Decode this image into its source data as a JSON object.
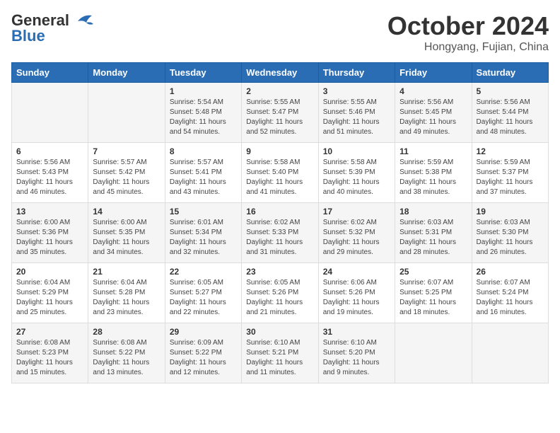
{
  "logo": {
    "text_general": "General",
    "text_blue": "Blue"
  },
  "header": {
    "month": "October 2024",
    "location": "Hongyang, Fujian, China"
  },
  "weekdays": [
    "Sunday",
    "Monday",
    "Tuesday",
    "Wednesday",
    "Thursday",
    "Friday",
    "Saturday"
  ],
  "weeks": [
    [
      {
        "day": "",
        "info": ""
      },
      {
        "day": "",
        "info": ""
      },
      {
        "day": "1",
        "info": "Sunrise: 5:54 AM\nSunset: 5:48 PM\nDaylight: 11 hours and 54 minutes."
      },
      {
        "day": "2",
        "info": "Sunrise: 5:55 AM\nSunset: 5:47 PM\nDaylight: 11 hours and 52 minutes."
      },
      {
        "day": "3",
        "info": "Sunrise: 5:55 AM\nSunset: 5:46 PM\nDaylight: 11 hours and 51 minutes."
      },
      {
        "day": "4",
        "info": "Sunrise: 5:56 AM\nSunset: 5:45 PM\nDaylight: 11 hours and 49 minutes."
      },
      {
        "day": "5",
        "info": "Sunrise: 5:56 AM\nSunset: 5:44 PM\nDaylight: 11 hours and 48 minutes."
      }
    ],
    [
      {
        "day": "6",
        "info": "Sunrise: 5:56 AM\nSunset: 5:43 PM\nDaylight: 11 hours and 46 minutes."
      },
      {
        "day": "7",
        "info": "Sunrise: 5:57 AM\nSunset: 5:42 PM\nDaylight: 11 hours and 45 minutes."
      },
      {
        "day": "8",
        "info": "Sunrise: 5:57 AM\nSunset: 5:41 PM\nDaylight: 11 hours and 43 minutes."
      },
      {
        "day": "9",
        "info": "Sunrise: 5:58 AM\nSunset: 5:40 PM\nDaylight: 11 hours and 41 minutes."
      },
      {
        "day": "10",
        "info": "Sunrise: 5:58 AM\nSunset: 5:39 PM\nDaylight: 11 hours and 40 minutes."
      },
      {
        "day": "11",
        "info": "Sunrise: 5:59 AM\nSunset: 5:38 PM\nDaylight: 11 hours and 38 minutes."
      },
      {
        "day": "12",
        "info": "Sunrise: 5:59 AM\nSunset: 5:37 PM\nDaylight: 11 hours and 37 minutes."
      }
    ],
    [
      {
        "day": "13",
        "info": "Sunrise: 6:00 AM\nSunset: 5:36 PM\nDaylight: 11 hours and 35 minutes."
      },
      {
        "day": "14",
        "info": "Sunrise: 6:00 AM\nSunset: 5:35 PM\nDaylight: 11 hours and 34 minutes."
      },
      {
        "day": "15",
        "info": "Sunrise: 6:01 AM\nSunset: 5:34 PM\nDaylight: 11 hours and 32 minutes."
      },
      {
        "day": "16",
        "info": "Sunrise: 6:02 AM\nSunset: 5:33 PM\nDaylight: 11 hours and 31 minutes."
      },
      {
        "day": "17",
        "info": "Sunrise: 6:02 AM\nSunset: 5:32 PM\nDaylight: 11 hours and 29 minutes."
      },
      {
        "day": "18",
        "info": "Sunrise: 6:03 AM\nSunset: 5:31 PM\nDaylight: 11 hours and 28 minutes."
      },
      {
        "day": "19",
        "info": "Sunrise: 6:03 AM\nSunset: 5:30 PM\nDaylight: 11 hours and 26 minutes."
      }
    ],
    [
      {
        "day": "20",
        "info": "Sunrise: 6:04 AM\nSunset: 5:29 PM\nDaylight: 11 hours and 25 minutes."
      },
      {
        "day": "21",
        "info": "Sunrise: 6:04 AM\nSunset: 5:28 PM\nDaylight: 11 hours and 23 minutes."
      },
      {
        "day": "22",
        "info": "Sunrise: 6:05 AM\nSunset: 5:27 PM\nDaylight: 11 hours and 22 minutes."
      },
      {
        "day": "23",
        "info": "Sunrise: 6:05 AM\nSunset: 5:26 PM\nDaylight: 11 hours and 21 minutes."
      },
      {
        "day": "24",
        "info": "Sunrise: 6:06 AM\nSunset: 5:26 PM\nDaylight: 11 hours and 19 minutes."
      },
      {
        "day": "25",
        "info": "Sunrise: 6:07 AM\nSunset: 5:25 PM\nDaylight: 11 hours and 18 minutes."
      },
      {
        "day": "26",
        "info": "Sunrise: 6:07 AM\nSunset: 5:24 PM\nDaylight: 11 hours and 16 minutes."
      }
    ],
    [
      {
        "day": "27",
        "info": "Sunrise: 6:08 AM\nSunset: 5:23 PM\nDaylight: 11 hours and 15 minutes."
      },
      {
        "day": "28",
        "info": "Sunrise: 6:08 AM\nSunset: 5:22 PM\nDaylight: 11 hours and 13 minutes."
      },
      {
        "day": "29",
        "info": "Sunrise: 6:09 AM\nSunset: 5:22 PM\nDaylight: 11 hours and 12 minutes."
      },
      {
        "day": "30",
        "info": "Sunrise: 6:10 AM\nSunset: 5:21 PM\nDaylight: 11 hours and 11 minutes."
      },
      {
        "day": "31",
        "info": "Sunrise: 6:10 AM\nSunset: 5:20 PM\nDaylight: 11 hours and 9 minutes."
      },
      {
        "day": "",
        "info": ""
      },
      {
        "day": "",
        "info": ""
      }
    ]
  ]
}
